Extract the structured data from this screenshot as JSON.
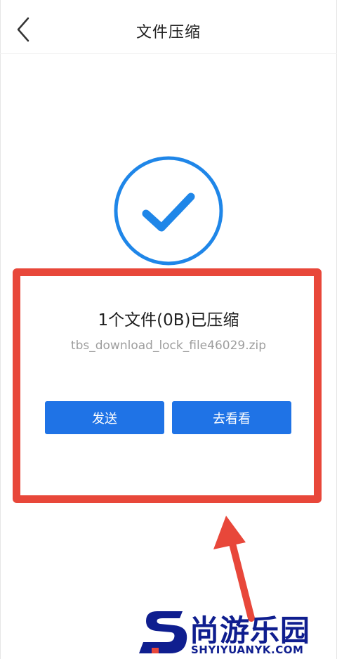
{
  "header": {
    "title": "文件压缩",
    "back_icon": "chevron-left-icon"
  },
  "result": {
    "title": "1个文件(0B)已压缩",
    "file_name": "tbs_download_lock_file46029.zip",
    "icon": "check-circle-icon"
  },
  "actions": {
    "send_label": "发送",
    "view_label": "去看看"
  },
  "watermark": {
    "name_cn": "尚游乐园",
    "name_en": "SHYIYUANYK.COM"
  },
  "colors": {
    "accent": "#1f73e6",
    "annotation": "#e8473a",
    "watermark": "#0f1e8f"
  }
}
